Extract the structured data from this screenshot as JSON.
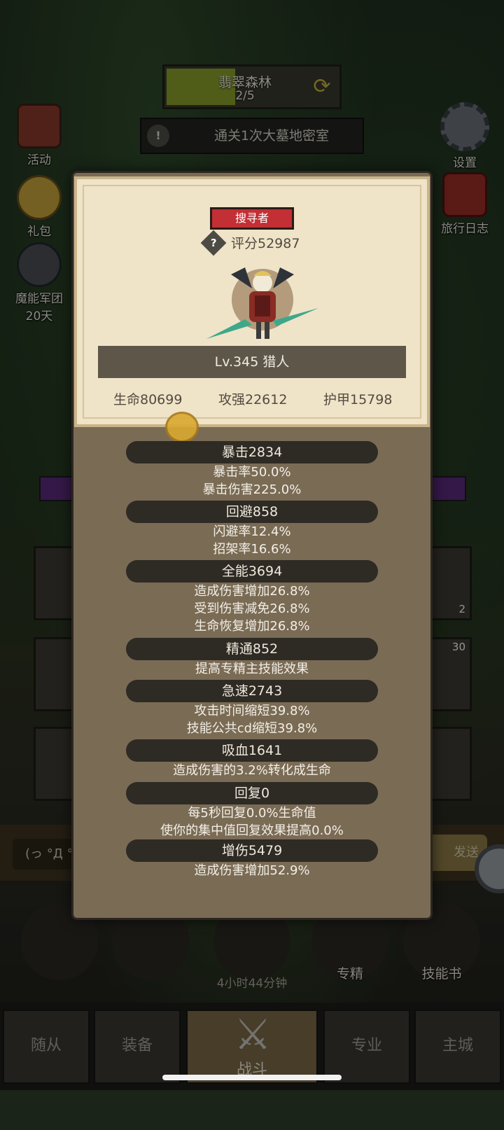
{
  "stage": {
    "name": "翡翠森林",
    "progress": "2/5",
    "fill_fraction": 0.4
  },
  "quest": {
    "icon": "!",
    "text": "通关1次大墓地密室"
  },
  "side_left": [
    {
      "label": "活动",
      "icon": "event-scroll-icon"
    },
    {
      "label": "礼包",
      "icon": "gift-coin-icon"
    },
    {
      "label": "魔能军团",
      "sub": "20天",
      "icon": "legion-helmet-icon"
    }
  ],
  "side_right": [
    {
      "label": "设置",
      "icon": "gear-icon"
    },
    {
      "label": "旅行日志",
      "icon": "journal-book-icon"
    }
  ],
  "cards_right_badges": [
    "2",
    "30"
  ],
  "chat": {
    "input_text": "(っ °Д °",
    "send_label": "发送"
  },
  "actions": [
    {
      "label": "",
      "icon": "potion-icon"
    },
    {
      "label": "",
      "icon": "bread-icon"
    },
    {
      "label": "",
      "icon": "treasure-chest-icon"
    },
    {
      "label": "专精",
      "icon": "specialization-icon"
    },
    {
      "label": "技能书",
      "icon": "skill-book-icon"
    }
  ],
  "timer": "4小时44分钟",
  "nav": {
    "follower": "随从",
    "equipment": "装备",
    "battle": "战斗",
    "profession": "专业",
    "main_city": "主城"
  },
  "popup": {
    "class_tag": "搜寻者",
    "score": "评分52987",
    "level": "Lv.345 猎人",
    "hp": "生命80699",
    "attack": "攻强22612",
    "armor": "护甲15798",
    "sections": [
      {
        "title": "暴击2834",
        "lines": [
          "暴击率50.0%",
          "暴击伤害225.0%"
        ]
      },
      {
        "title": "回避858",
        "lines": [
          "闪避率12.4%",
          "招架率16.6%"
        ]
      },
      {
        "title": "全能3694",
        "lines": [
          "造成伤害增加26.8%",
          "受到伤害减免26.8%",
          "生命恢复增加26.8%"
        ]
      },
      {
        "title": "精通852",
        "lines": [
          "提高专精主技能效果"
        ]
      },
      {
        "title": "急速2743",
        "lines": [
          "攻击时间缩短39.8%",
          "技能公共cd缩短39.8%"
        ]
      },
      {
        "title": "吸血1641",
        "lines": [
          "造成伤害的3.2%转化成生命"
        ]
      },
      {
        "title": "回复0",
        "lines": [
          "每5秒回复0.0%生命值",
          "使你的集中值回复效果提高0.0%"
        ]
      },
      {
        "title": "增伤5479",
        "lines": [
          "造成伤害增加52.9%"
        ]
      }
    ]
  }
}
